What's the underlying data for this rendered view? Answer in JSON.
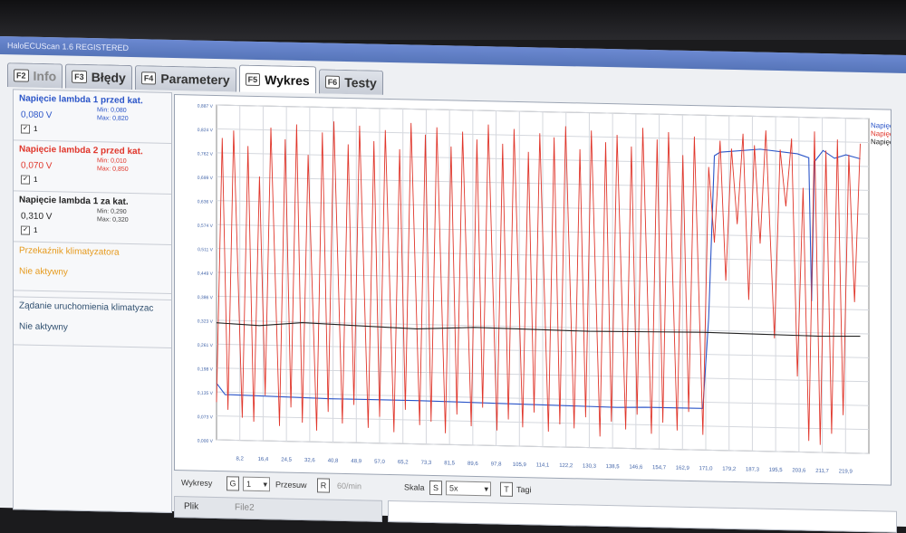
{
  "app": {
    "title": "HaloECUScan 1.6 REGISTERED"
  },
  "tabs": [
    {
      "key": "F2",
      "label": "Info"
    },
    {
      "key": "F3",
      "label": "Błędy"
    },
    {
      "key": "F4",
      "label": "Parametery"
    },
    {
      "key": "F5",
      "label": "Wykres"
    },
    {
      "key": "F6",
      "label": "Testy"
    }
  ],
  "signals": [
    {
      "name": "Napięcie lambda 1 przed kat.",
      "value": "0,080 V",
      "min": "Min: 0,080",
      "max": "Max: 0,820",
      "checked": "✓",
      "num": "1",
      "color": "#2b55c8"
    },
    {
      "name": "Napięcie lambda 2 przed kat.",
      "value": "0,070 V",
      "min": "Min: 0,010",
      "max": "Max: 0,850",
      "checked": "✓",
      "num": "1",
      "color": "#e0362b"
    },
    {
      "name": "Napięcie lambda 1 za kat.",
      "value": "0,310 V",
      "min": "Min: 0,290",
      "max": "Max: 0,320",
      "checked": "✓",
      "num": "1",
      "color": "#222222"
    }
  ],
  "statuses": [
    {
      "name": "Przekaźnik klimatyzatora",
      "state": "Nie aktywny",
      "color": "#e69a1d"
    },
    {
      "name": "Żądanie uruchomienia klimatyzac",
      "state": "Nie aktywny",
      "color": "#2f4f6f"
    }
  ],
  "legend": [
    "Napięcie lambd",
    "Napięcie lambd",
    "Napięcie lamb"
  ],
  "controls": {
    "wykresy_label": "Wykresy",
    "wykresy_key": "G",
    "wykresy_value": "1",
    "przesuw_label": "Przesuw",
    "przesuw_key": "R",
    "przesuw_value": "60/min",
    "skala_label": "Skala",
    "skala_key": "S",
    "skala_value": "5x",
    "tagi_key": "T",
    "tagi_label": "Tagi",
    "plik_label": "Plik",
    "plik_value": "File2",
    "dropdown_arrow": "▾"
  },
  "chart_data": {
    "type": "line",
    "y_ticks": [
      "0,000 V",
      "0,073 V",
      "0,135 V",
      "0,198 V",
      "0,261 V",
      "0,323 V",
      "0,386 V",
      "0,449 V",
      "0,511 V",
      "0,574 V",
      "0,636 V",
      "0,699 V",
      "0,762 V",
      "0,824 V",
      "0,887 V"
    ],
    "x_ticks": [
      "8,2",
      "16,4",
      "24,5",
      "32,6",
      "40,8",
      "48,9",
      "57,0",
      "65,2",
      "73,3",
      "81,5",
      "89,6",
      "97,8",
      "105,9",
      "114,1",
      "122,2",
      "130,3",
      "138,5",
      "146,6",
      "154,7",
      "162,9",
      "171,0",
      "179,2",
      "187,3",
      "195,5",
      "203,6",
      "211,7",
      "219,9"
    ],
    "xlim": [
      0,
      228
    ],
    "ylim": [
      0,
      0.887
    ],
    "grid": true,
    "series": [
      {
        "name": "Napięcie lambda 1 przed kat.",
        "color": "#2b55c8",
        "points": [
          [
            0,
            0.15
          ],
          [
            3,
            0.12
          ],
          [
            5,
            0.12
          ],
          [
            40,
            0.115
          ],
          [
            70,
            0.115
          ],
          [
            100,
            0.112
          ],
          [
            120,
            0.11
          ],
          [
            140,
            0.108
          ],
          [
            150,
            0.11
          ],
          [
            170,
            0.11
          ],
          [
            172,
            0.35
          ],
          [
            174,
            0.78
          ],
          [
            176,
            0.79
          ],
          [
            190,
            0.8
          ],
          [
            203,
            0.79
          ],
          [
            207,
            0.78
          ],
          [
            208,
            0.4
          ],
          [
            209,
            0.77
          ],
          [
            212,
            0.8
          ],
          [
            216,
            0.78
          ],
          [
            220,
            0.79
          ],
          [
            225,
            0.78
          ]
        ]
      },
      {
        "name": "Napięcie lambda 2 przed kat.",
        "color": "#e0362b",
        "points": [
          [
            0,
            0.1
          ],
          [
            2,
            0.8
          ],
          [
            4,
            0.08
          ],
          [
            6,
            0.82
          ],
          [
            9,
            0.06
          ],
          [
            11,
            0.78
          ],
          [
            13,
            0.05
          ],
          [
            15,
            0.7
          ],
          [
            17,
            0.12
          ],
          [
            19,
            0.83
          ],
          [
            22,
            0.04
          ],
          [
            24,
            0.8
          ],
          [
            26,
            0.09
          ],
          [
            28,
            0.84
          ],
          [
            30,
            0.05
          ],
          [
            32,
            0.76
          ],
          [
            35,
            0.03
          ],
          [
            37,
            0.82
          ],
          [
            39,
            0.08
          ],
          [
            41,
            0.85
          ],
          [
            44,
            0.05
          ],
          [
            46,
            0.79
          ],
          [
            48,
            0.1
          ],
          [
            50,
            0.84
          ],
          [
            53,
            0.04
          ],
          [
            55,
            0.8
          ],
          [
            57,
            0.07
          ],
          [
            59,
            0.83
          ],
          [
            62,
            0.03
          ],
          [
            64,
            0.78
          ],
          [
            66,
            0.09
          ],
          [
            68,
            0.85
          ],
          [
            71,
            0.05
          ],
          [
            73,
            0.82
          ],
          [
            75,
            0.06
          ],
          [
            77,
            0.84
          ],
          [
            80,
            0.03
          ],
          [
            82,
            0.79
          ],
          [
            84,
            0.08
          ],
          [
            86,
            0.83
          ],
          [
            89,
            0.05
          ],
          [
            91,
            0.81
          ],
          [
            93,
            0.1
          ],
          [
            95,
            0.85
          ],
          [
            98,
            0.04
          ],
          [
            100,
            0.8
          ],
          [
            102,
            0.07
          ],
          [
            104,
            0.84
          ],
          [
            107,
            0.05
          ],
          [
            109,
            0.78
          ],
          [
            111,
            0.09
          ],
          [
            113,
            0.83
          ],
          [
            116,
            0.04
          ],
          [
            118,
            0.82
          ],
          [
            120,
            0.06
          ],
          [
            122,
            0.85
          ],
          [
            125,
            0.05
          ],
          [
            127,
            0.79
          ],
          [
            129,
            0.08
          ],
          [
            131,
            0.84
          ],
          [
            134,
            0.03
          ],
          [
            136,
            0.81
          ],
          [
            138,
            0.07
          ],
          [
            140,
            0.83
          ],
          [
            143,
            0.05
          ],
          [
            145,
            0.8
          ],
          [
            147,
            0.09
          ],
          [
            149,
            0.85
          ],
          [
            152,
            0.04
          ],
          [
            154,
            0.82
          ],
          [
            156,
            0.07
          ],
          [
            158,
            0.84
          ],
          [
            161,
            0.05
          ],
          [
            163,
            0.78
          ],
          [
            165,
            0.1
          ],
          [
            167,
            0.83
          ],
          [
            170,
            0.04
          ],
          [
            172,
            0.75
          ],
          [
            174,
            0.55
          ],
          [
            176,
            0.82
          ],
          [
            178,
            0.45
          ],
          [
            180,
            0.8
          ],
          [
            182,
            0.6
          ],
          [
            184,
            0.84
          ],
          [
            186,
            0.4
          ],
          [
            188,
            0.81
          ],
          [
            190,
            0.55
          ],
          [
            192,
            0.85
          ],
          [
            195,
            0.3
          ],
          [
            197,
            0.8
          ],
          [
            199,
            0.65
          ],
          [
            201,
            0.83
          ],
          [
            203,
            0.2
          ],
          [
            205,
            0.7
          ],
          [
            207,
            0.03
          ],
          [
            209,
            0.85
          ],
          [
            211,
            0.02
          ],
          [
            213,
            0.8
          ],
          [
            215,
            0.05
          ],
          [
            217,
            0.83
          ],
          [
            219,
            0.1
          ],
          [
            221,
            0.79
          ],
          [
            223,
            0.4
          ],
          [
            225,
            0.82
          ]
        ]
      },
      {
        "name": "Napięcie lambda 1 za kat.",
        "color": "#222222",
        "points": [
          [
            0,
            0.31
          ],
          [
            15,
            0.305
          ],
          [
            30,
            0.315
          ],
          [
            50,
            0.31
          ],
          [
            70,
            0.305
          ],
          [
            90,
            0.312
          ],
          [
            110,
            0.31
          ],
          [
            130,
            0.308
          ],
          [
            150,
            0.31
          ],
          [
            170,
            0.312
          ],
          [
            190,
            0.31
          ],
          [
            210,
            0.308
          ],
          [
            225,
            0.31
          ]
        ]
      }
    ]
  }
}
